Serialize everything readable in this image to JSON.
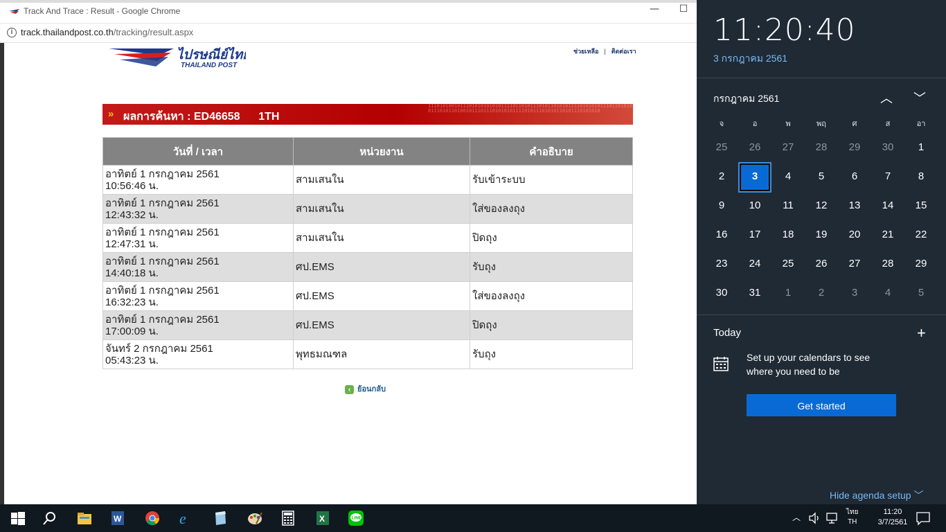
{
  "browser": {
    "window_title": "Track And Trace : Result - Google Chrome",
    "url_host": "track.thailandpost.co.th",
    "url_path": "/tracking/result.aspx"
  },
  "site": {
    "logo_text_thai": "ไปรษณีย์ไทย",
    "logo_text_en": "THAILAND POST",
    "link_help": "ช่วยเหลือ",
    "link_contact": "ติดต่อเรา",
    "link_sep": "|"
  },
  "banner": {
    "arrows": "»",
    "title": "ผลการค้นหา : ED46658      1TH",
    "binary": "1110101001011101010101010111101101011101011010101111010101011101101010101110101101001011101110101010111101011101010110101110101010"
  },
  "table": {
    "headers": [
      "วันที่ / เวลา",
      "หน่วยงาน",
      "คำอธิบาย"
    ],
    "rows": [
      {
        "date": "อาทิตย์ 1 กรกฎาคม 2561",
        "time": "10:56:46 น.",
        "unit": "สามเสนใน",
        "desc": "รับเข้าระบบ"
      },
      {
        "date": "อาทิตย์ 1 กรกฎาคม 2561",
        "time": "12:43:32 น.",
        "unit": "สามเสนใน",
        "desc": "ใส่ของลงถุง"
      },
      {
        "date": "อาทิตย์ 1 กรกฎาคม 2561",
        "time": "12:47:31 น.",
        "unit": "สามเสนใน",
        "desc": "ปิดถุง"
      },
      {
        "date": "อาทิตย์ 1 กรกฎาคม 2561",
        "time": "14:40:18 น.",
        "unit": "ศป.EMS",
        "desc": "รับถุง"
      },
      {
        "date": "อาทิตย์ 1 กรกฎาคม 2561",
        "time": "16:32:23 น.",
        "unit": "ศป.EMS",
        "desc": "ใส่ของลงถุง"
      },
      {
        "date": "อาทิตย์ 1 กรกฎาคม 2561",
        "time": "17:00:09 น.",
        "unit": "ศป.EMS",
        "desc": "ปิดถุง"
      },
      {
        "date": "จันทร์ 2 กรกฎาคม 2561",
        "time": "05:43:23 น.",
        "unit": "พุทธมณฑล",
        "desc": "รับถุง"
      }
    ]
  },
  "back_link": "ย้อนกลับ",
  "panel": {
    "clock": "11:20:40",
    "date_long": "3 กรกฎาคม 2561",
    "month_label": "กรกฎาคม 2561",
    "weekdays": [
      "จ",
      "อ",
      "พ",
      "พฤ",
      "ศ",
      "ส",
      "อา"
    ],
    "weeks": [
      [
        {
          "d": "25",
          "dim": true
        },
        {
          "d": "26",
          "dim": true
        },
        {
          "d": "27",
          "dim": true
        },
        {
          "d": "28",
          "dim": true
        },
        {
          "d": "29",
          "dim": true
        },
        {
          "d": "30",
          "dim": true
        },
        {
          "d": "1"
        }
      ],
      [
        {
          "d": "2"
        },
        {
          "d": "3",
          "today": true
        },
        {
          "d": "4"
        },
        {
          "d": "5"
        },
        {
          "d": "6"
        },
        {
          "d": "7"
        },
        {
          "d": "8"
        }
      ],
      [
        {
          "d": "9"
        },
        {
          "d": "10"
        },
        {
          "d": "11"
        },
        {
          "d": "12"
        },
        {
          "d": "13"
        },
        {
          "d": "14"
        },
        {
          "d": "15"
        }
      ],
      [
        {
          "d": "16"
        },
        {
          "d": "17"
        },
        {
          "d": "18"
        },
        {
          "d": "19"
        },
        {
          "d": "20"
        },
        {
          "d": "21"
        },
        {
          "d": "22"
        }
      ],
      [
        {
          "d": "23"
        },
        {
          "d": "24"
        },
        {
          "d": "25"
        },
        {
          "d": "26"
        },
        {
          "d": "27"
        },
        {
          "d": "28"
        },
        {
          "d": "29"
        }
      ],
      [
        {
          "d": "30"
        },
        {
          "d": "31"
        },
        {
          "d": "1",
          "dim": true
        },
        {
          "d": "2",
          "dim": true
        },
        {
          "d": "3",
          "dim": true
        },
        {
          "d": "4",
          "dim": true
        },
        {
          "d": "5",
          "dim": true
        }
      ]
    ],
    "today_label": "Today",
    "setup_text": "Set up your calendars to see where you need to be",
    "get_started": "Get started",
    "hide_agenda": "Hide agenda setup"
  },
  "taskbar": {
    "lang_top": "ไทย",
    "lang_bottom": "TH",
    "time": "11:20",
    "date": "3/7/2561"
  },
  "colors": {
    "accent_blue": "#0a6ad5",
    "banner_red": "#b30000",
    "panel_bg": "#1f2a35"
  }
}
